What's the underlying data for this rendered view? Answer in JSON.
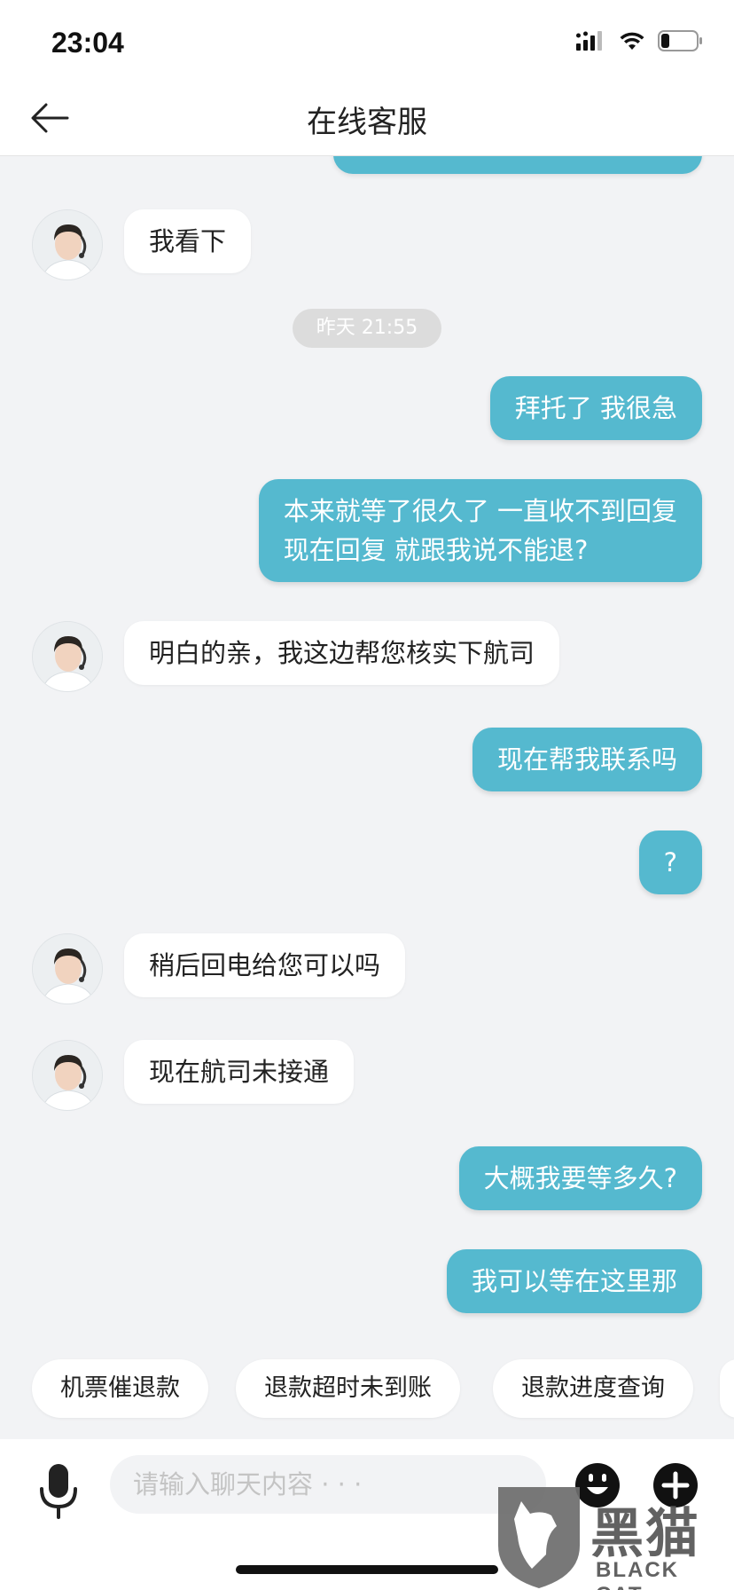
{
  "status_bar": {
    "time": "23:04"
  },
  "nav": {
    "title": "在线客服"
  },
  "messages": [
    {
      "side": "left",
      "text": "我看下"
    },
    {
      "type": "timestamp",
      "text": "昨天 21:55"
    },
    {
      "side": "right",
      "text": "拜托了 我很急"
    },
    {
      "side": "right",
      "text": "本来就等了很久了 一直收不到回复\n现在回复 就跟我说不能退?"
    },
    {
      "side": "left",
      "text": "明白的亲，我这边帮您核实下航司"
    },
    {
      "side": "right",
      "text": "现在帮我联系吗"
    },
    {
      "side": "right",
      "text": "?"
    },
    {
      "side": "left",
      "text": "稍后回电给您可以吗"
    },
    {
      "side": "left",
      "text": "现在航司未接通"
    },
    {
      "side": "right",
      "text": "大概我要等多久?"
    },
    {
      "side": "right",
      "text": "我可以等在这里那"
    }
  ],
  "quick_replies": [
    "机票催退款",
    "退款超时未到账",
    "退款进度查询"
  ],
  "input": {
    "placeholder": "请输入聊天内容 · · ·",
    "value": ""
  },
  "watermark": {
    "cn": "黑猫",
    "en": "BLACK CAT"
  },
  "colors": {
    "outgoing_bubble": "#55b9cf",
    "incoming_bubble": "#ffffff",
    "background": "#f2f3f5"
  },
  "icons": {
    "back": "back-arrow-icon",
    "mic": "microphone-icon",
    "emoji": "emoji-icon",
    "plus": "plus-icon"
  }
}
